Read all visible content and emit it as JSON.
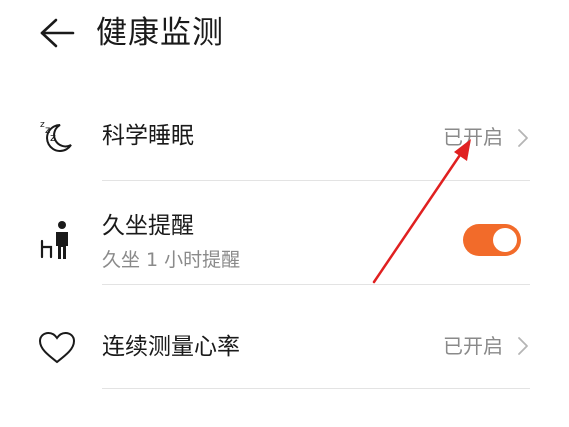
{
  "header": {
    "title": "健康监测",
    "back_icon": "back-arrow-icon"
  },
  "rows": [
    {
      "label": "科学睡眠",
      "value": "已开启",
      "icon": "sleep-moon-icon"
    },
    {
      "label": "久坐提醒",
      "sublabel": "久坐 1 小时提醒",
      "icon": "sedentary-person-chair-icon",
      "toggle_on": true
    },
    {
      "label": "连续测量心率",
      "value": "已开启",
      "icon": "heart-outline-icon"
    }
  ],
  "colors": {
    "toggle_on": "#f26b2a",
    "annotation_arrow": "#e02020"
  }
}
